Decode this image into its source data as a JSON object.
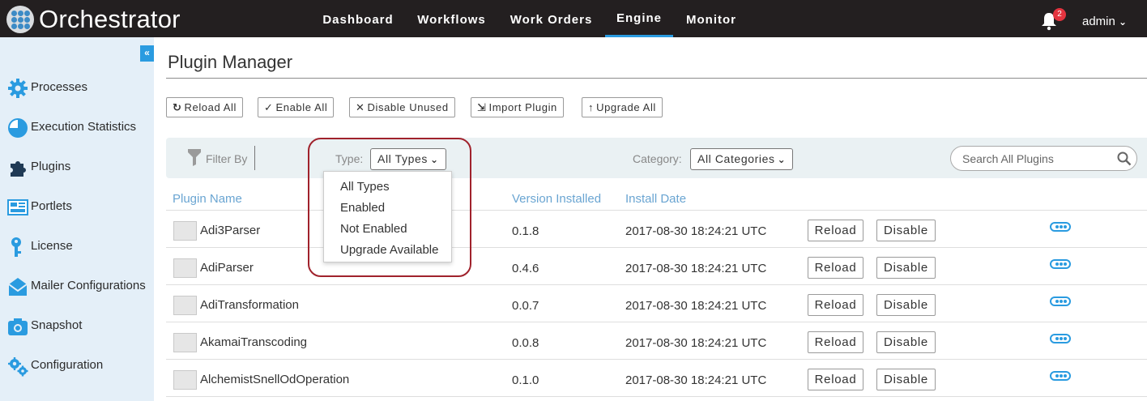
{
  "app": {
    "brand": "Orchestrator",
    "brand_color": "#231f20",
    "accent": "#2a9be0"
  },
  "nav": {
    "items": [
      {
        "label": "Dashboard",
        "active": false
      },
      {
        "label": "Workflows",
        "active": false
      },
      {
        "label": "Work Orders",
        "active": false
      },
      {
        "label": "Engine",
        "active": true
      },
      {
        "label": "Monitor",
        "active": false
      }
    ],
    "notifications": "2",
    "user": "admin"
  },
  "sidebar": {
    "collapse": "«",
    "items": [
      {
        "label": "Processes",
        "icon": "gear-icon"
      },
      {
        "label": "Execution Statistics",
        "icon": "pie-chart-icon"
      },
      {
        "label": "Plugins",
        "icon": "puzzle-icon"
      },
      {
        "label": "Portlets",
        "icon": "portlets-icon"
      },
      {
        "label": "License",
        "icon": "key-icon"
      },
      {
        "label": "Mailer Configurations",
        "icon": "envelope-icon"
      },
      {
        "label": "Snapshot",
        "icon": "camera-icon"
      },
      {
        "label": "Configuration",
        "icon": "gears-icon"
      }
    ]
  },
  "page": {
    "title": "Plugin Manager"
  },
  "toolbar": {
    "reload_all": "Reload All",
    "enable_all": "Enable All",
    "disable_unused": "Disable Unused",
    "import_plugin": "Import Plugin",
    "upgrade_all": "Upgrade All"
  },
  "filter": {
    "filter_by": "Filter By",
    "type_label": "Type:",
    "type_value": "All Types",
    "category_label": "Category:",
    "category_value": "All Categories",
    "search_placeholder": "Search All Plugins",
    "type_options": [
      "All Types",
      "Enabled",
      "Not Enabled",
      "Upgrade Available"
    ]
  },
  "table": {
    "columns": {
      "name": "Plugin Name",
      "version": "Version Installed",
      "date": "Install Date"
    },
    "reload_label": "Reload",
    "disable_label": "Disable",
    "rows": [
      {
        "name": "Adi3Parser",
        "version": "0.1.8",
        "date": "2017-08-30 18:24:21 UTC"
      },
      {
        "name": "AdiParser",
        "version": "0.4.6",
        "date": "2017-08-30 18:24:21 UTC"
      },
      {
        "name": "AdiTransformation",
        "version": "0.0.7",
        "date": "2017-08-30 18:24:21 UTC"
      },
      {
        "name": "AkamaiTranscoding",
        "version": "0.0.8",
        "date": "2017-08-30 18:24:21 UTC"
      },
      {
        "name": "AlchemistSnellOdOperation",
        "version": "0.1.0",
        "date": "2017-08-30 18:24:21 UTC"
      }
    ]
  }
}
